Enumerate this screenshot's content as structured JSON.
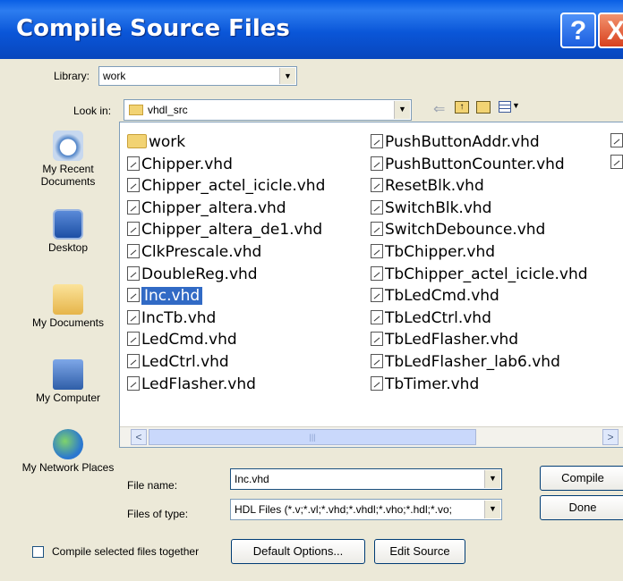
{
  "window": {
    "title": "Compile Source Files",
    "help_icon": "?",
    "close_icon": "X"
  },
  "library": {
    "label": "Library:",
    "value": "work"
  },
  "lookin": {
    "label": "Look in:",
    "value": "vhdl_src"
  },
  "toolbar": {
    "back_icon": "arrow-left-icon",
    "up_icon": "up-folder-icon",
    "new_folder_icon": "new-folder-icon",
    "view_icon": "view-menu-icon"
  },
  "places": [
    {
      "label": "My Recent Documents"
    },
    {
      "label": "Desktop"
    },
    {
      "label": "My Documents"
    },
    {
      "label": "My Computer"
    },
    {
      "label": "My Network Places"
    }
  ],
  "files": {
    "col1": [
      "work",
      "Chipper.vhd",
      "Chipper_actel_icicle.vhd",
      "Chipper_altera.vhd",
      "Chipper_altera_de1.vhd",
      "ClkPrescale.vhd",
      "DoubleReg.vhd",
      "Inc.vhd",
      "IncTb.vhd",
      "LedCmd.vhd",
      "LedCtrl.vhd",
      "LedFlasher.vhd"
    ],
    "col2": [
      "PushButtonAddr.vhd",
      "PushButtonCounter.vhd",
      "ResetBlk.vhd",
      "SwitchBlk.vhd",
      "SwitchDebounce.vhd",
      "TbChipper.vhd",
      "TbChipper_actel_icicle.vhd",
      "TbLedCmd.vhd",
      "TbLedCtrl.vhd",
      "TbLedFlasher.vhd",
      "TbLedFlasher_lab6.vhd",
      "TbTimer.vhd"
    ],
    "selected": "Inc.vhd"
  },
  "scroll": {
    "left": "<",
    "right": ">",
    "grip": "|||"
  },
  "filename": {
    "label": "File name:",
    "value": "Inc.vhd"
  },
  "filetype": {
    "label": "Files of type:",
    "value": "HDL Files (*.v;*.vl;*.vhd;*.vhdl;*.vho;*.hdl;*.vo;"
  },
  "buttons": {
    "compile": "Compile",
    "done": "Done",
    "default_options": "Default Options...",
    "edit_source": "Edit Source"
  },
  "compile_together": {
    "label": "Compile selected files together",
    "checked": false
  },
  "colors": {
    "title_blue": "#0a56d8",
    "selection": "#316ac5",
    "dialog_bg": "#ece9d8"
  }
}
